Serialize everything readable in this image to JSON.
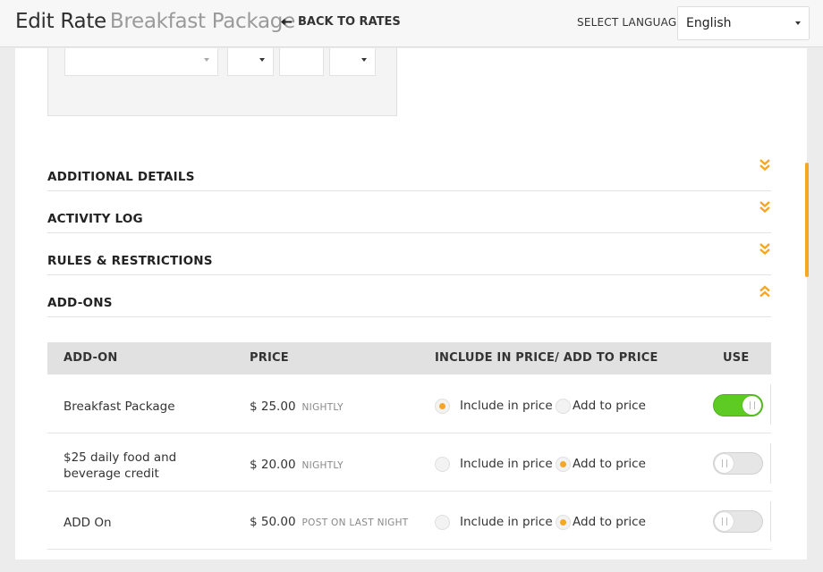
{
  "header": {
    "title": "Edit Rate",
    "subtitle": "Breakfast Package",
    "back_label": "BACK TO RATES",
    "language_label": "SELECT LANGUAGE",
    "language_value": "English"
  },
  "sections": [
    {
      "label": "ADDITIONAL DETAILS",
      "state": "collapsed"
    },
    {
      "label": "ACTIVITY LOG",
      "state": "collapsed"
    },
    {
      "label": "RULES & RESTRICTIONS",
      "state": "collapsed"
    },
    {
      "label": "ADD-ONS",
      "state": "expanded"
    }
  ],
  "addons_table": {
    "headers": {
      "addon": "ADD-ON",
      "price": "PRICE",
      "include": "INCLUDE IN PRICE/ ADD TO PRICE",
      "use": "USE"
    },
    "option_include": "Include in price",
    "option_add": "Add to price",
    "rows": [
      {
        "name": "Breakfast Package",
        "price": "$ 25.00",
        "unit": "NIGHTLY",
        "selected": "include",
        "use": true
      },
      {
        "name": "$25 daily food and beverage credit",
        "price": "$ 20.00",
        "unit": "NIGHTLY",
        "selected": "add",
        "use": false
      },
      {
        "name": "ADD On",
        "price": "$ 50.00",
        "unit": "POST ON LAST NIGHT",
        "selected": "add",
        "use": false
      }
    ]
  },
  "colors": {
    "accent": "#f5a623",
    "toggle_on": "#5ecb24"
  }
}
